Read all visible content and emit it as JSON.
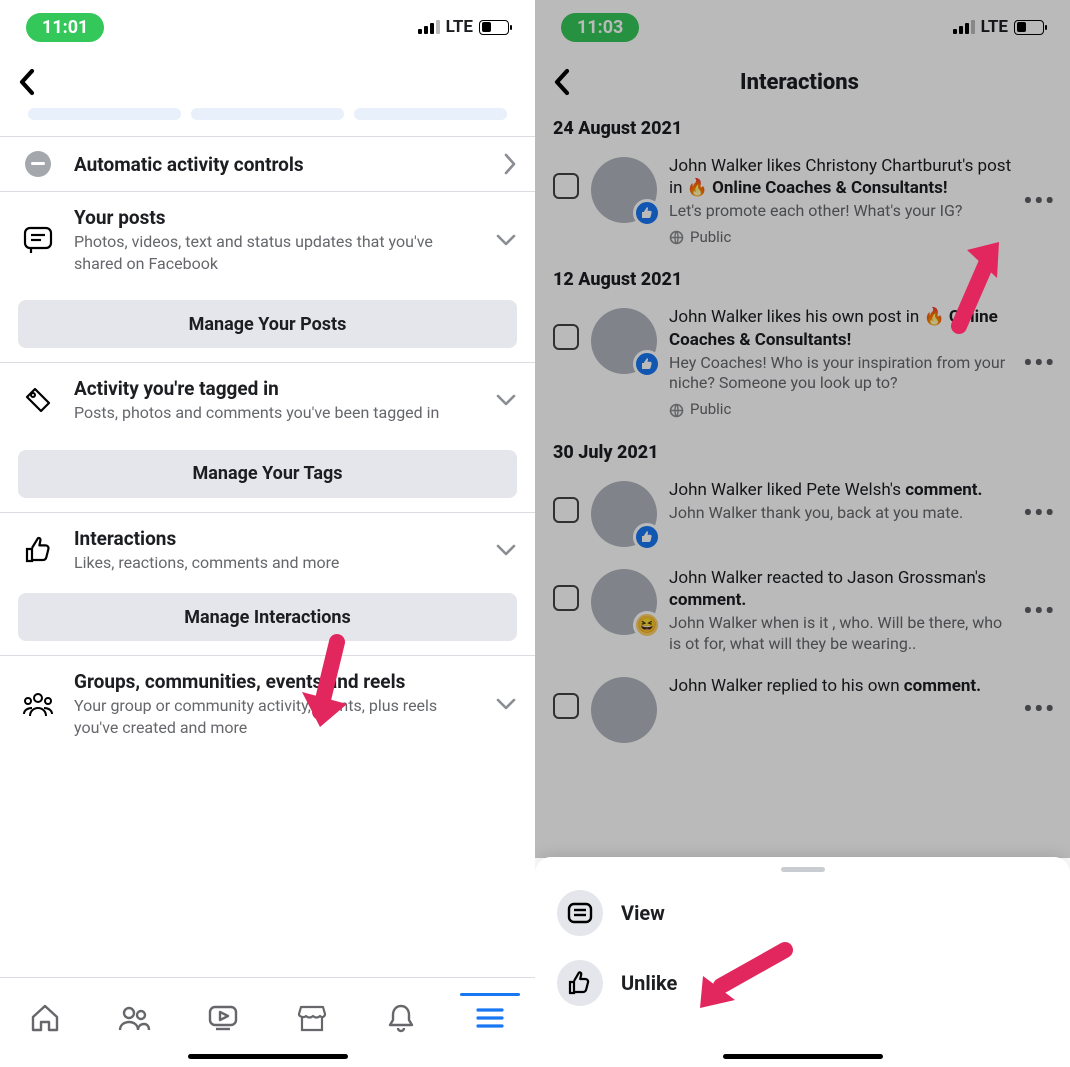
{
  "left": {
    "status": {
      "time": "11:01",
      "net": "LTE"
    },
    "auto_controls": "Automatic activity controls",
    "sections": [
      {
        "title": "Your posts",
        "sub": "Photos, videos, text and status updates that you've shared on Facebook",
        "button": "Manage Your Posts"
      },
      {
        "title": "Activity you're tagged in",
        "sub": "Posts, photos and comments you've been tagged in",
        "button": "Manage Your Tags"
      },
      {
        "title": "Interactions",
        "sub": "Likes, reactions, comments and more",
        "button": "Manage Interactions"
      },
      {
        "title": "Groups, communities, events and reels",
        "sub": "Your group or community activity, events, plus reels you've created and more",
        "button": ""
      }
    ]
  },
  "right": {
    "status": {
      "time": "11:03",
      "net": "LTE"
    },
    "header": "Interactions",
    "groups": [
      {
        "date": "24 August 2021",
        "items": [
          {
            "title_pre": "John Walker likes Christony Chartburut's post in ",
            "emoji": "🔥",
            "title_bold": "Online Coaches & Consultants!",
            "desc": "Let's promote each other! What's your IG?",
            "visibility": "Public",
            "badge": "like"
          }
        ]
      },
      {
        "date": "12 August 2021",
        "items": [
          {
            "title_pre": "John Walker likes his own post in ",
            "emoji": "🔥",
            "title_bold": "Online Coaches & Consultants!",
            "desc": "Hey Coaches! Who is your inspiration from your niche? Someone you look up to?",
            "visibility": "Public",
            "badge": "like"
          }
        ]
      },
      {
        "date": "30 July 2021",
        "items": [
          {
            "title_pre": "John Walker liked Pete Welsh's ",
            "emoji": "",
            "title_bold": "comment.",
            "desc": "John Walker thank you, back at you mate.",
            "visibility": "",
            "badge": "like"
          },
          {
            "title_pre": "John Walker reacted to Jason Grossman's ",
            "emoji": "",
            "title_bold": "comment.",
            "desc": "John Walker when is it , who. Will be there, who is ot for, what will they be wearing..",
            "visibility": "",
            "badge": "laugh"
          },
          {
            "title_pre": "John Walker replied to his own ",
            "emoji": "",
            "title_bold": "comment.",
            "desc": "",
            "visibility": "",
            "badge": "none"
          }
        ]
      }
    ],
    "sheet": {
      "view": "View",
      "unlike": "Unlike"
    }
  }
}
